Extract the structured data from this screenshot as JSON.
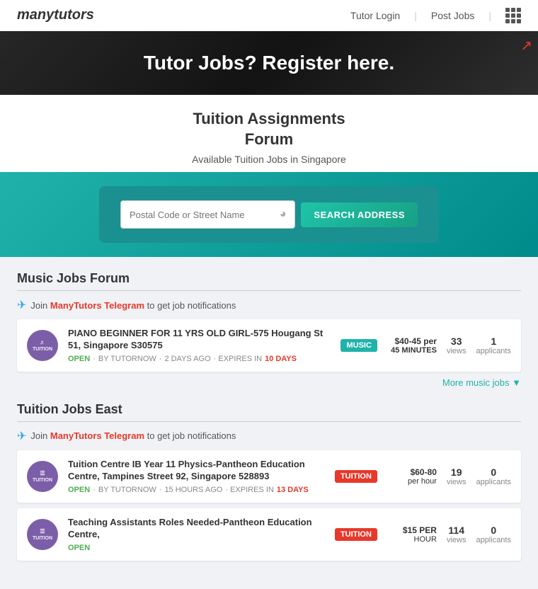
{
  "header": {
    "logo": "manytutors",
    "nav": [
      {
        "label": "Tutor Login",
        "id": "tutor-login"
      },
      {
        "label": "Post Jobs",
        "id": "post-jobs"
      }
    ]
  },
  "banner": {
    "text": "Tutor Jobs? Register here."
  },
  "page": {
    "title": "Tuition Assignments\nForum",
    "subtitle": "Available Tuition Jobs in Singapore"
  },
  "search": {
    "placeholder": "Postal Code or Street Name",
    "button_label": "SEARCH ADDRESS"
  },
  "sections": [
    {
      "id": "music-jobs",
      "title": "Music Jobs Forum",
      "telegram_text": "Join ManyTutors Telegram to get job notifications",
      "telegram_link": "ManyTutors Telegram",
      "jobs": [
        {
          "category": "MUSIC",
          "badge_class": "badge-music",
          "title": "PIANO BEGINNER FOR 11 YRS OLD GIRL-575 Hougang St 51, Singapore S30575",
          "status": "OPEN",
          "posted_by": "BY TUTORNOW",
          "posted_time": "2 DAYS AGO",
          "expires": "10 DAYS",
          "rate": "$40-45 per 45 MINUTES",
          "views": "33",
          "applicants": "1"
        }
      ],
      "more_link": "More music jobs",
      "more_arrow": "▼"
    },
    {
      "id": "tuition-jobs-east",
      "title": "Tuition Jobs East",
      "telegram_text": "Join ManyTutors Telegram to get job notifications",
      "telegram_link": "ManyTutors Telegram",
      "jobs": [
        {
          "category": "TUITION",
          "badge_class": "badge-tuition",
          "title": "Tuition Centre IB Year 11 Physics-Pantheon Education Centre, Tampines Street 92, Singapore 528893",
          "status": "OPEN",
          "posted_by": "BY TUTORNOW",
          "posted_time": "15 HOURS AGO",
          "expires": "13 DAYS",
          "rate": "$60-80 per hour",
          "views": "19",
          "applicants": "0"
        },
        {
          "category": "TUITION",
          "badge_class": "badge-red",
          "title": "Teaching Assistants Roles Needed-Pantheon Education Centre,",
          "status": "OPEN",
          "posted_by": "",
          "posted_time": "",
          "expires": "",
          "rate": "$15 PER HOUR",
          "views": "114",
          "applicants": "0"
        }
      ]
    }
  ],
  "more_label": "More"
}
